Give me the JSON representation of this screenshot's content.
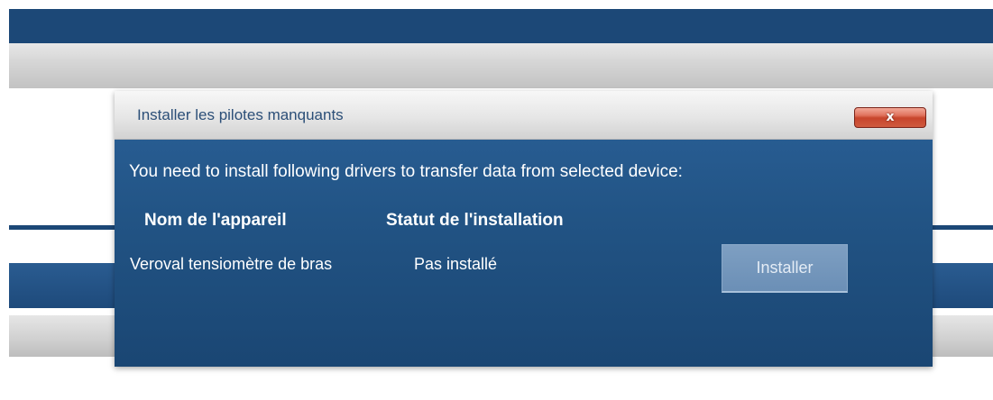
{
  "dialog": {
    "title": "Installer les pilotes manquants",
    "close_glyph": "x",
    "message": "You need to install following drivers to transfer data from selected device:",
    "table": {
      "headers": [
        "Nom de l'appareil",
        "Statut de l'installation"
      ],
      "rows": [
        [
          "Veroval tensiomètre de bras",
          "Pas installé"
        ]
      ]
    },
    "install_label": "Installer"
  },
  "colors": {
    "header_blue": "#1c4877",
    "dialog_blue": "#225485",
    "close_red": "#c7452c",
    "button_gray_blue": "#6b8fb6"
  },
  "icons": {
    "close": "close-icon"
  }
}
